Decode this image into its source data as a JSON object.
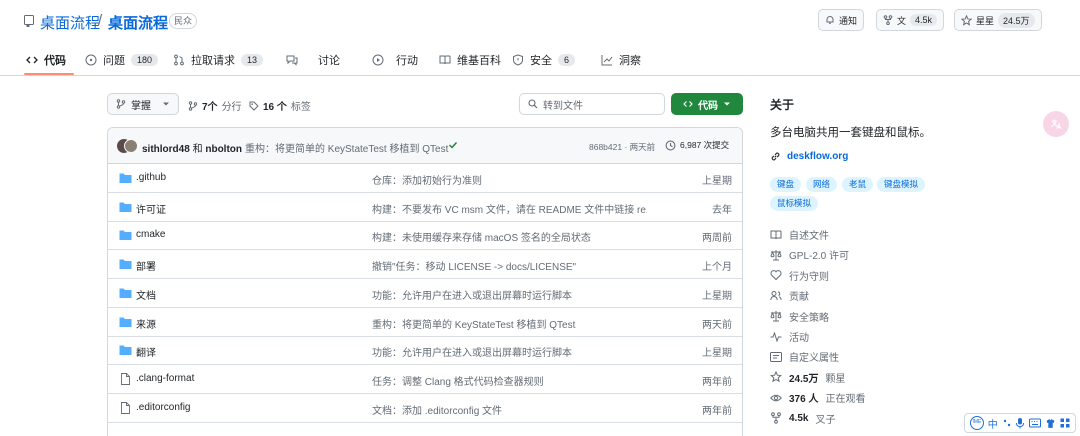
{
  "repo": {
    "owner": "桌面流程",
    "separator": "/",
    "name": "桌面流程",
    "visibility": "民众"
  },
  "header_buttons": {
    "notify": "通知",
    "fork_label": "文",
    "fork_count": "4.5k",
    "star_label": "星星",
    "star_count": "24.5万"
  },
  "tabs": [
    {
      "label": "代码",
      "count": "",
      "icon": "code-icon"
    },
    {
      "label": "问题",
      "count": "180",
      "icon": "issue-icon"
    },
    {
      "label": "拉取请求",
      "count": "13",
      "icon": "pull-request-icon"
    },
    {
      "label": "讨论",
      "count": "",
      "icon": "discussion-icon"
    },
    {
      "label": "行动",
      "count": "",
      "icon": "play-icon"
    },
    {
      "label": "维基百科",
      "count": "",
      "icon": "book-icon"
    },
    {
      "label": "安全",
      "count": "6",
      "icon": "shield-icon"
    },
    {
      "label": "洞察",
      "count": "",
      "icon": "graph-icon"
    }
  ],
  "toolbar": {
    "branch": "掌握",
    "branches_count": "7个",
    "branches_label": "分行",
    "tags_count": "16 个",
    "tags_label": "标签",
    "search_placeholder": "转到文件",
    "code_button": "代码"
  },
  "commit": {
    "author1": "sithlord48",
    "and": "和",
    "author2": "nbolton",
    "message": "重构：将更简单的 KeyStateTest 移植到 QTest",
    "sha_time": "868b421 · 两天前",
    "commits": "6,987 次提交"
  },
  "files": [
    {
      "type": "folder",
      "name": ".github",
      "message": "仓库：添加初始行为准则",
      "time": "上星期"
    },
    {
      "type": "folder",
      "name": "许可证",
      "message": "构建：不要发布 VC msm 文件，请在 README 文件中链接 re...",
      "time": "去年"
    },
    {
      "type": "folder",
      "name": "cmake",
      "message": "构建：未使用缓存来存储 macOS 签名的全局状态",
      "time": "两周前"
    },
    {
      "type": "folder",
      "name": "部署",
      "message": "撤销\"任务：移动 LICENSE -> docs/LICENSE\"",
      "time": "上个月"
    },
    {
      "type": "folder",
      "name": "文档",
      "message": "功能：允许用户在进入或退出屏幕时运行脚本",
      "time": "上星期"
    },
    {
      "type": "folder",
      "name": "来源",
      "message": "重构：将更简单的 KeyStateTest 移植到 QTest",
      "time": "两天前"
    },
    {
      "type": "folder",
      "name": "翻译",
      "message": "功能：允许用户在进入或退出屏幕时运行脚本",
      "time": "上星期"
    },
    {
      "type": "file",
      "name": ".clang-format",
      "message": "任务：调整 Clang 格式代码检查器规则",
      "time": "两年前"
    },
    {
      "type": "file",
      "name": ".editorconfig",
      "message": "文档：添加 .editorconfig 文件",
      "time": "两年前"
    }
  ],
  "about": {
    "title": "关于",
    "description": "多台电脑共用一套键盘和鼠标。",
    "link": "deskflow.org",
    "topics": [
      "键盘",
      "网络",
      "老鼠",
      "键盘模拟",
      "鼠标模拟"
    ],
    "items": [
      {
        "icon": "book-icon",
        "strong": "",
        "label": "自述文件"
      },
      {
        "icon": "law-icon",
        "strong": "",
        "label": "GPL-2.0 许可"
      },
      {
        "icon": "heart-icon",
        "strong": "",
        "label": "行为守则"
      },
      {
        "icon": "people-icon",
        "strong": "",
        "label": "贡献"
      },
      {
        "icon": "law-icon",
        "strong": "",
        "label": "安全策略"
      },
      {
        "icon": "pulse-icon",
        "strong": "",
        "label": "活动"
      },
      {
        "icon": "note-icon",
        "strong": "",
        "label": "自定义属性"
      },
      {
        "icon": "star-icon",
        "strong": "24.5万",
        "label": "颗星"
      },
      {
        "icon": "eye-icon",
        "strong": "376 人",
        "label": "正在观看"
      },
      {
        "icon": "fork-icon",
        "strong": "4.5k",
        "label": "叉子"
      }
    ]
  },
  "ime": {
    "lang": "中"
  }
}
